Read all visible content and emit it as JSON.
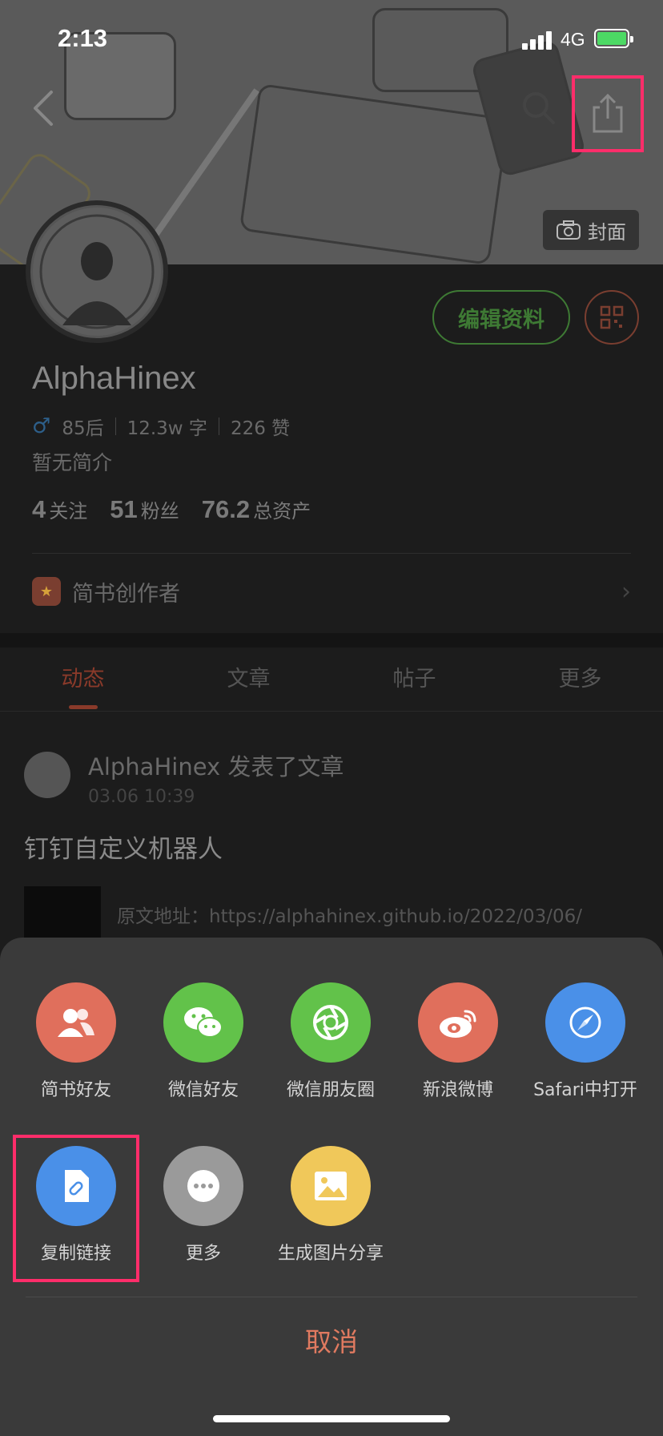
{
  "status_bar": {
    "time": "2:13",
    "network": "4G"
  },
  "cover": {
    "cover_button_label": "封面"
  },
  "profile": {
    "username": "AlphaHinex",
    "age_group": "85后",
    "word_count": "12.3w 字",
    "likes": "226 赞",
    "bio": "暂无简介",
    "edit_label": "编辑资料",
    "stats": [
      {
        "value": "4",
        "label": "关注"
      },
      {
        "value": "51",
        "label": "粉丝"
      },
      {
        "value": "76.2",
        "label": "总资产"
      }
    ],
    "author_label": "简书创作者"
  },
  "tabs": [
    {
      "label": "动态"
    },
    {
      "label": "文章"
    },
    {
      "label": "帖子"
    },
    {
      "label": "更多"
    }
  ],
  "feed": {
    "head": "AlphaHinex 发表了文章",
    "time": "03.06 10:39",
    "title": "钉钉自定义机器人",
    "body": "原文地址：https://alphahinex.github.io/2022/03/06/"
  },
  "share_sheet": {
    "row1": [
      {
        "label": "简书好友",
        "icon": "users-icon",
        "color": "#e06f5c"
      },
      {
        "label": "微信好友",
        "icon": "wechat-icon",
        "color": "#62c24a"
      },
      {
        "label": "微信朋友圈",
        "icon": "moments-icon",
        "color": "#62c24a"
      },
      {
        "label": "新浪微博",
        "icon": "weibo-icon",
        "color": "#e06f5c"
      },
      {
        "label": "Safari中打开",
        "icon": "compass-icon",
        "color": "#4a90e8"
      }
    ],
    "row2": [
      {
        "label": "复制链接",
        "icon": "link-icon",
        "color": "#4a90e8"
      },
      {
        "label": "更多",
        "icon": "more-icon",
        "color": "#9a9a9a"
      },
      {
        "label": "生成图片分享",
        "icon": "image-icon",
        "color": "#f0c85a"
      }
    ],
    "cancel_label": "取消"
  },
  "colors": {
    "highlight": "#ff2d6a",
    "sheet_bg": "#3a3a3a",
    "cancel": "#e07a60"
  }
}
